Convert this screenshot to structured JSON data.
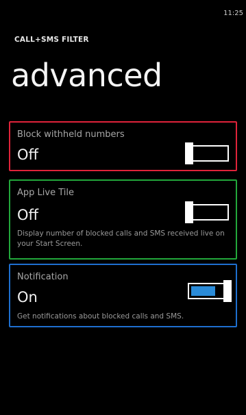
{
  "status_bar": {
    "time": "11:25"
  },
  "header": {
    "app_title": "CALL+SMS FILTER",
    "page_title": "advanced"
  },
  "settings": [
    {
      "label": "Block withheld numbers",
      "state": "Off",
      "description": "",
      "on": false,
      "border_color": "#e0233a"
    },
    {
      "label": "App Live Tile",
      "state": "Off",
      "description": "Display number of blocked calls and SMS received live on your Start Screen.",
      "on": false,
      "border_color": "#22a83b"
    },
    {
      "label": "Notification",
      "state": "On",
      "description": "Get notifications about blocked calls and SMS.",
      "on": true,
      "border_color": "#1e6fd0"
    }
  ],
  "colors": {
    "background": "#000000",
    "accent": "#2a8bd8",
    "text_primary": "#ffffff",
    "text_secondary": "#a8a8a8"
  },
  "icons": {
    "toggle": "toggle-switch"
  }
}
